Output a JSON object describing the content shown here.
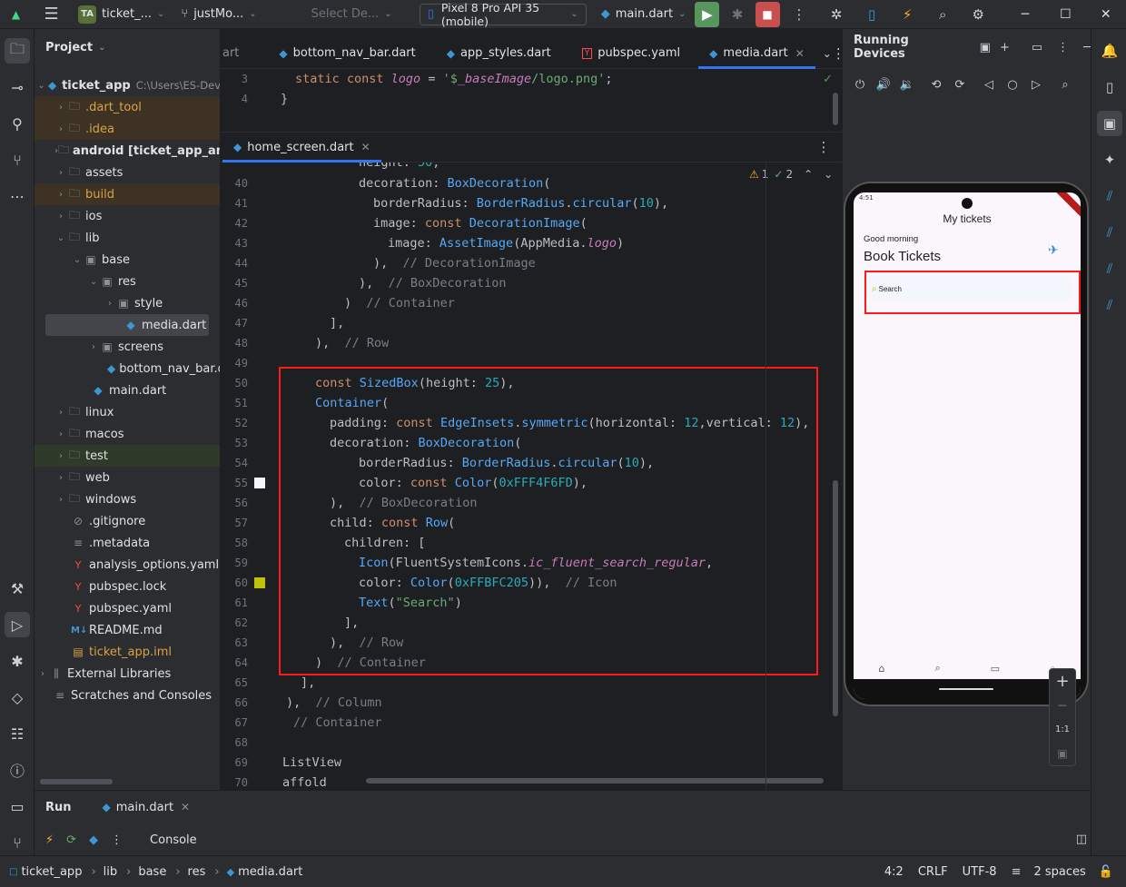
{
  "titlebar": {
    "project_badge": "TA",
    "project_name": "ticket_...",
    "branch": "justMo...",
    "select_device": "Select De...",
    "device": "Pixel 8 Pro API 35 (mobile)",
    "run_config": "main.dart"
  },
  "project_panel": {
    "title": "Project",
    "root": "ticket_app",
    "root_path": "C:\\Users\\ES-Dev",
    "items": [
      {
        "label": ".dart_tool"
      },
      {
        "label": ".idea"
      },
      {
        "label": "android [ticket_app_andro"
      },
      {
        "label": "assets"
      },
      {
        "label": "build"
      },
      {
        "label": "ios"
      },
      {
        "label": "lib"
      },
      {
        "label": "base"
      },
      {
        "label": "res"
      },
      {
        "label": "style"
      },
      {
        "label": "media.dart"
      },
      {
        "label": "screens"
      },
      {
        "label": "bottom_nav_bar.dar"
      },
      {
        "label": "main.dart"
      },
      {
        "label": "linux"
      },
      {
        "label": "macos"
      },
      {
        "label": "test"
      },
      {
        "label": "web"
      },
      {
        "label": "windows"
      },
      {
        "label": ".gitignore"
      },
      {
        "label": ".metadata"
      },
      {
        "label": "analysis_options.yaml"
      },
      {
        "label": "pubspec.lock"
      },
      {
        "label": "pubspec.yaml"
      },
      {
        "label": "README.md"
      },
      {
        "label": "ticket_app.iml"
      },
      {
        "label": "External Libraries"
      },
      {
        "label": "Scratches and Consoles"
      }
    ]
  },
  "top_tabs": [
    {
      "label": "art"
    },
    {
      "label": "bottom_nav_bar.dart"
    },
    {
      "label": "app_styles.dart"
    },
    {
      "label": "pubspec.yaml"
    },
    {
      "label": "media.dart"
    }
  ],
  "top_editor": {
    "lines": [
      {
        "n": "3"
      },
      {
        "n": "4"
      }
    ]
  },
  "bottom_tab": {
    "label": "home_screen.dart"
  },
  "inspections": {
    "warnings": "1",
    "weak": "2"
  },
  "line_numbers": [
    "40",
    "41",
    "42",
    "43",
    "44",
    "45",
    "46",
    "47",
    "48",
    "49",
    "50",
    "51",
    "52",
    "53",
    "54",
    "55",
    "56",
    "57",
    "58",
    "59",
    "60",
    "61",
    "62",
    "63",
    "64",
    "65",
    "66",
    "67",
    "68",
    "69",
    "70"
  ],
  "devices_panel": {
    "title": "Running Devices",
    "app": {
      "appbar_title": "My tickets",
      "greeting": "Good morning",
      "heading": "Book Tickets",
      "search_placeholder": "Search",
      "status_time": "4:51"
    },
    "zoom_label": "1:1"
  },
  "run_panel": {
    "tab_run": "Run",
    "tab_file": "main.dart",
    "console": "Console"
  },
  "statusbar": {
    "crumbs": [
      "ticket_app",
      "lib",
      "base",
      "res",
      "media.dart"
    ],
    "position": "4:2",
    "line_sep": "CRLF",
    "encoding": "UTF-8",
    "indent": "2 spaces"
  },
  "colors": {
    "highlight_box": "#ff1a1a",
    "accent": "#3574f0",
    "swatch_white": "#f4f6fd",
    "swatch_yellow": "#bfc205"
  }
}
